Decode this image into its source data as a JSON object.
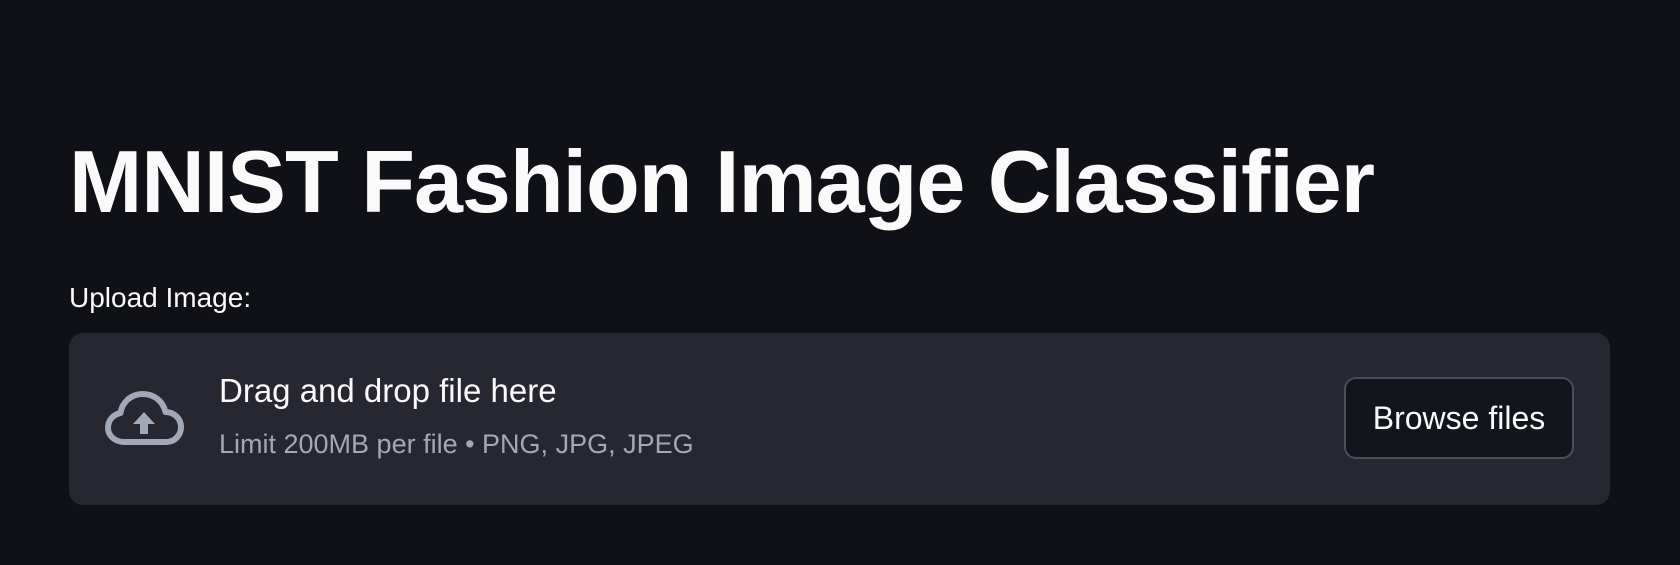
{
  "page": {
    "title": "MNIST Fashion Image Classifier"
  },
  "uploader": {
    "label": "Upload Image:",
    "drop_text": "Drag and drop file here",
    "limit_text": "Limit 200MB per file • PNG, JPG, JPEG",
    "browse_label": "Browse files",
    "icon": "cloud-upload-icon"
  },
  "colors": {
    "background": "#0f1117",
    "dropzone": "#262730",
    "text_primary": "#fafafa",
    "text_secondary": "#a3a8b8",
    "button_border": "#4b4e59"
  }
}
